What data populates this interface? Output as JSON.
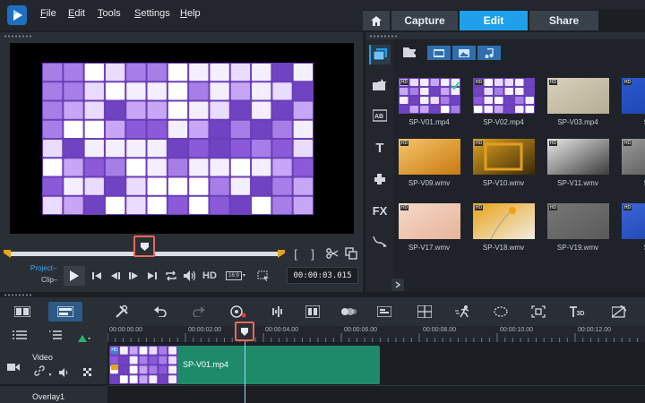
{
  "menu": {
    "items": [
      {
        "label": "File",
        "accel": "F",
        "rest": "ile"
      },
      {
        "label": "Edit",
        "accel": "E",
        "rest": "dit"
      },
      {
        "label": "Tools",
        "accel": "T",
        "rest": "ools"
      },
      {
        "label": "Settings",
        "accel": "S",
        "rest": "ettings"
      },
      {
        "label": "Help",
        "accel": "H",
        "rest": "elp"
      }
    ]
  },
  "tabs": {
    "capture": "Capture",
    "edit": "Edit",
    "share": "Share",
    "active": "Edit"
  },
  "player": {
    "project_label": "Project",
    "clip_label": "Clip",
    "hd_label": "HD",
    "aspect_label": "16:9",
    "timecode": "00:00:03.015",
    "scrub_position": 0.5
  },
  "library": {
    "side_text": {
      "title": "T",
      "fx": "FX"
    },
    "badge": "HD",
    "thumbnails": [
      {
        "label": "SP-V01.mp4",
        "checked": true
      },
      {
        "label": "SP-V02.mp4"
      },
      {
        "label": "SP-V03.mp4"
      },
      {
        "label": "SP-V"
      },
      {
        "label": "SP-V09.wmv"
      },
      {
        "label": "SP-V10.wmv"
      },
      {
        "label": "SP-V11.wmv"
      },
      {
        "label": "SP-V"
      },
      {
        "label": "SP-V17.wmv"
      },
      {
        "label": "SP-V18.wmv"
      },
      {
        "label": "SP-V19.wmv"
      },
      {
        "label": "SP-V"
      }
    ]
  },
  "timeline": {
    "toolbar_text": "3D",
    "ruler": [
      "00:00:00.00",
      "00:00:02.00",
      "00:00:04.00",
      "00:00:06.00",
      "00:00:08.00",
      "00:00:10.00",
      "00:00:12.00"
    ],
    "tracks": [
      {
        "name": "Video"
      },
      {
        "name": "Overlay1"
      }
    ],
    "clip": {
      "label": "SP-V01.mp4"
    }
  },
  "colors": {
    "accent": "#1ea0ea",
    "clip": "#1f8a6a",
    "highlight": "#e8685a",
    "scrub": "#e8a319"
  }
}
